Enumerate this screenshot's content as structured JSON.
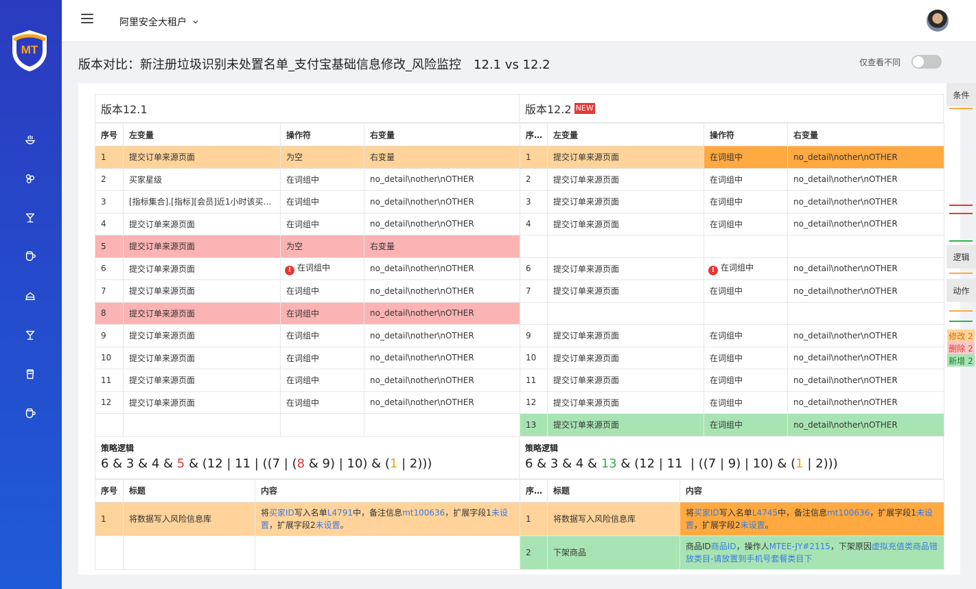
{
  "app": {
    "tenant": "阿里安全大租户",
    "logo_text": "MT"
  },
  "page": {
    "title": "版本对比：新注册垃圾识别未处置名单_支付宝基础信息修改_风险监控",
    "vs": "12.1 vs 12.2",
    "diff_only_label": "仅查看不同"
  },
  "sidebar": {
    "icons": [
      "bowl-icon",
      "cluster-icon",
      "cup-icon",
      "teapot-icon",
      "cake-icon",
      "cocktail-icon",
      "jar-icon",
      "kettle-icon"
    ]
  },
  "minimap": {
    "tab_condition": "条件",
    "tab_logic": "逻辑",
    "tab_action": "动作",
    "modified": "修改 2",
    "deleted": "删除 2",
    "added": "新增 2",
    "colors": {
      "modified": "#ffa940",
      "deleted": "#e53935",
      "added": "#2eb34a"
    }
  },
  "headers": {
    "seq": "序号",
    "left": "左变量",
    "op": "操作符",
    "right": "右变量",
    "title": "标题",
    "content": "内容"
  },
  "left": {
    "version": "版本12.1",
    "rows": [
      {
        "seq": "1",
        "left": "提交订单来源页面",
        "op": "为空",
        "right": "右变量"
      },
      {
        "seq": "2",
        "left": "买家星级",
        "op": "在词组中",
        "right": "no_detail\\nother\\nOTHER"
      },
      {
        "seq": "3",
        "left": "[指标集合].[指标][会员]近1小时该买家...",
        "op": "在词组中",
        "right": "no_detail\\nother\\nOTHER"
      },
      {
        "seq": "4",
        "left": "提交订单来源页面",
        "op": "在词组中",
        "right": "no_detail\\nother\\nOTHER"
      },
      {
        "seq": "5",
        "left": "提交订单来源页面",
        "op": "为空",
        "right": "右变量"
      },
      {
        "seq": "6",
        "left": "提交订单来源页面",
        "op": "在词组中",
        "right": "no_detail\\nother\\nOTHER"
      },
      {
        "seq": "7",
        "left": "提交订单来源页面",
        "op": "在词组中",
        "right": "no_detail\\nother\\nOTHER"
      },
      {
        "seq": "8",
        "left": "提交订单来源页面",
        "op": "在词组中",
        "right": "no_detail\\nother\\nOTHER"
      },
      {
        "seq": "9",
        "left": "提交订单来源页面",
        "op": "在词组中",
        "right": "no_detail\\nother\\nOTHER"
      },
      {
        "seq": "10",
        "left": "提交订单来源页面",
        "op": "在词组中",
        "right": "no_detail\\nother\\nOTHER"
      },
      {
        "seq": "11",
        "left": "提交订单来源页面",
        "op": "在词组中",
        "right": "no_detail\\nother\\nOTHER"
      },
      {
        "seq": "12",
        "left": "提交订单来源页面",
        "op": "在词组中",
        "right": "no_detail\\nother\\nOTHER"
      }
    ],
    "logic_label": "策略逻辑",
    "logic": [
      "6 & 3 & 4 & ",
      "5",
      " & (12 | 11 | ((7 | (",
      "8",
      " & 9) | 10) & (",
      "1",
      " | 2)))"
    ],
    "action": {
      "seq": "1",
      "title": "将数据写入风险信息库",
      "c": [
        "将",
        "买家ID",
        "写入名单",
        "L4791",
        "中，备注信息",
        "mt100636",
        "，扩展字段1",
        "未设置",
        "，扩展字段2",
        "未设置",
        "。"
      ]
    }
  },
  "right": {
    "version": "版本12.2",
    "new_badge": "NEW",
    "rows": [
      {
        "seq": "1",
        "left": "提交订单来源页面",
        "op": "在词组中",
        "right": "no_detail\\nother\\nOTHER"
      },
      {
        "seq": "2",
        "left": "提交订单来源页面",
        "op": "在词组中",
        "right": "no_detail\\nother\\nOTHER"
      },
      {
        "seq": "3",
        "left": "提交订单来源页面",
        "op": "在词组中",
        "right": "no_detail\\nother\\nOTHER"
      },
      {
        "seq": "4",
        "left": "提交订单来源页面",
        "op": "在词组中",
        "right": "no_detail\\nother\\nOTHER"
      },
      {
        "seq": "6",
        "left": "提交订单来源页面",
        "op": "在词组中",
        "right": "no_detail\\nother\\nOTHER"
      },
      {
        "seq": "7",
        "left": "提交订单来源页面",
        "op": "在词组中",
        "right": "no_detail\\nother\\nOTHER"
      },
      {
        "seq": "9",
        "left": "提交订单来源页面",
        "op": "在词组中",
        "right": "no_detail\\nother\\nOTHER"
      },
      {
        "seq": "10",
        "left": "提交订单来源页面",
        "op": "在词组中",
        "right": "no_detail\\nother\\nOTHER"
      },
      {
        "seq": "11",
        "left": "提交订单来源页面",
        "op": "在词组中",
        "right": "no_detail\\nother\\nOTHER"
      },
      {
        "seq": "12",
        "left": "提交订单来源页面",
        "op": "在词组中",
        "right": "no_detail\\nother\\nOTHER"
      },
      {
        "seq": "13",
        "left": "提交订单来源页面",
        "op": "在词组中",
        "right": "no_detail\\nother\\nOTHER"
      }
    ],
    "logic_label": "策略逻辑",
    "logic": [
      "6 & 3 & 4 & ",
      "13",
      " & (12 | 11 &nbsp;| ((7 | 9) | 10) & (",
      "1",
      " | 2)))"
    ],
    "action1": {
      "seq": "1",
      "title": "将数据写入风险信息库",
      "c": [
        "将",
        "买家ID",
        "写入名单",
        "L4745",
        "中，备注信息",
        "mt100636",
        "，扩展字段1",
        "未设置",
        "，扩展字段2",
        "未设置",
        "。"
      ]
    },
    "action2": {
      "seq": "2",
      "title": "下架商品",
      "c": [
        "商品ID",
        "商品ID",
        "，操作人",
        "MTEE-JY#2115",
        "，下架原因",
        "虚拟充值类商品错放类目-请放置到手机号套餐类目下"
      ]
    }
  }
}
